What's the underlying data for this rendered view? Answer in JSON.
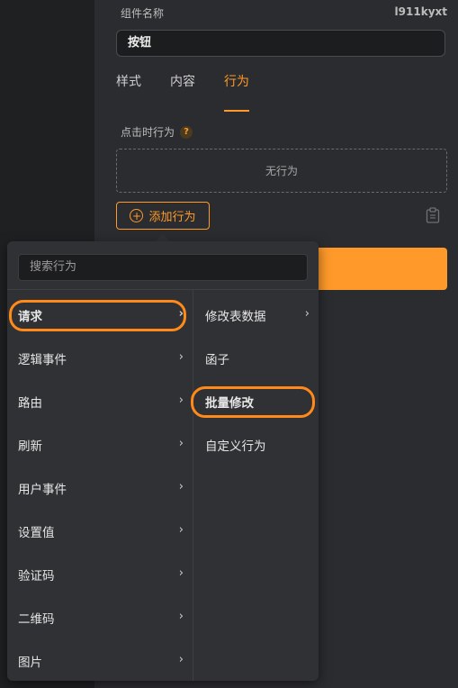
{
  "component": {
    "label": "组件名称",
    "id": "l911kyxt",
    "name_value": "按钮"
  },
  "tabs": [
    {
      "label": "样式"
    },
    {
      "label": "内容"
    },
    {
      "label": "行为"
    }
  ],
  "behavior": {
    "section_label": "点击时行为",
    "help": "?",
    "empty_text": "无行为",
    "add_button_label": "添加行为"
  },
  "dropdown": {
    "search_placeholder": "搜索行为",
    "left_items": [
      {
        "label": "请求"
      },
      {
        "label": "逻辑事件"
      },
      {
        "label": "路由"
      },
      {
        "label": "刷新"
      },
      {
        "label": "用户事件"
      },
      {
        "label": "设置值"
      },
      {
        "label": "验证码"
      },
      {
        "label": "二维码"
      },
      {
        "label": "图片"
      }
    ],
    "right_items": [
      {
        "label": "修改表数据"
      },
      {
        "label": "函子"
      },
      {
        "label": "批量修改"
      },
      {
        "label": "自定义行为"
      }
    ],
    "chevron": "›"
  },
  "colors": {
    "accent": "#ff9a2a",
    "highlight": "#ff8a1a",
    "panel": "#2b2c2f",
    "dropdown": "#303134"
  }
}
